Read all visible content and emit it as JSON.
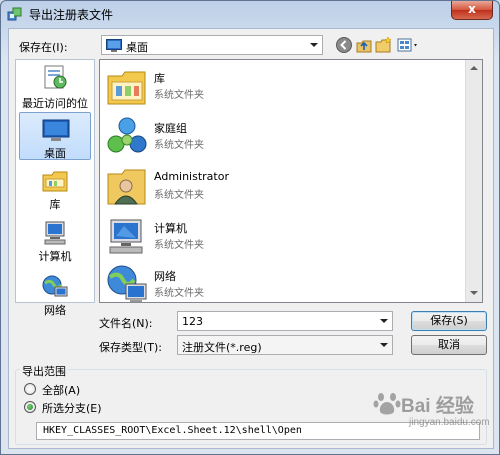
{
  "window": {
    "title": "导出注册表文件",
    "close_label": "x"
  },
  "save_in": {
    "label": "保存在(I):",
    "value": "桌面"
  },
  "toolbar": {
    "back_icon": "back-arrow-icon",
    "up_icon": "up-folder-icon",
    "new_folder_icon": "new-folder-icon",
    "views_icon": "views-menu-icon"
  },
  "places": [
    {
      "label": "最近访问的位置",
      "icon": "recent-places-icon"
    },
    {
      "label": "桌面",
      "icon": "desktop-icon",
      "selected": true
    },
    {
      "label": "库",
      "icon": "libraries-icon"
    },
    {
      "label": "计算机",
      "icon": "computer-icon"
    },
    {
      "label": "网络",
      "icon": "network-icon"
    }
  ],
  "files": [
    {
      "name": "库",
      "type": "系统文件夹",
      "icon": "libraries-icon"
    },
    {
      "name": "家庭组",
      "type": "系统文件夹",
      "icon": "homegroup-icon"
    },
    {
      "name": "Administrator",
      "type": "系统文件夹",
      "icon": "user-folder-icon"
    },
    {
      "name": "计算机",
      "type": "系统文件夹",
      "icon": "computer-icon"
    },
    {
      "name": "网络",
      "type": "系统文件夹",
      "icon": "network-icon"
    }
  ],
  "filename": {
    "label": "文件名(N):",
    "value": "123"
  },
  "filetype": {
    "label": "保存类型(T):",
    "value": "注册文件(*.reg)"
  },
  "buttons": {
    "save": "保存(S)",
    "cancel": "取消"
  },
  "export_range": {
    "title": "导出范围",
    "all_label": "全部(A)",
    "branch_label": "所选分支(E)",
    "selected": "branch",
    "branch_path": "HKEY_CLASSES_ROOT\\Excel.Sheet.12\\shell\\Open"
  },
  "watermark": {
    "text": "Bai 经验",
    "sub": "jingyan.baidu.com"
  },
  "colors": {
    "selection": "#c1dcfc",
    "accent": "#3c7fb1",
    "close": "#c0301c"
  }
}
